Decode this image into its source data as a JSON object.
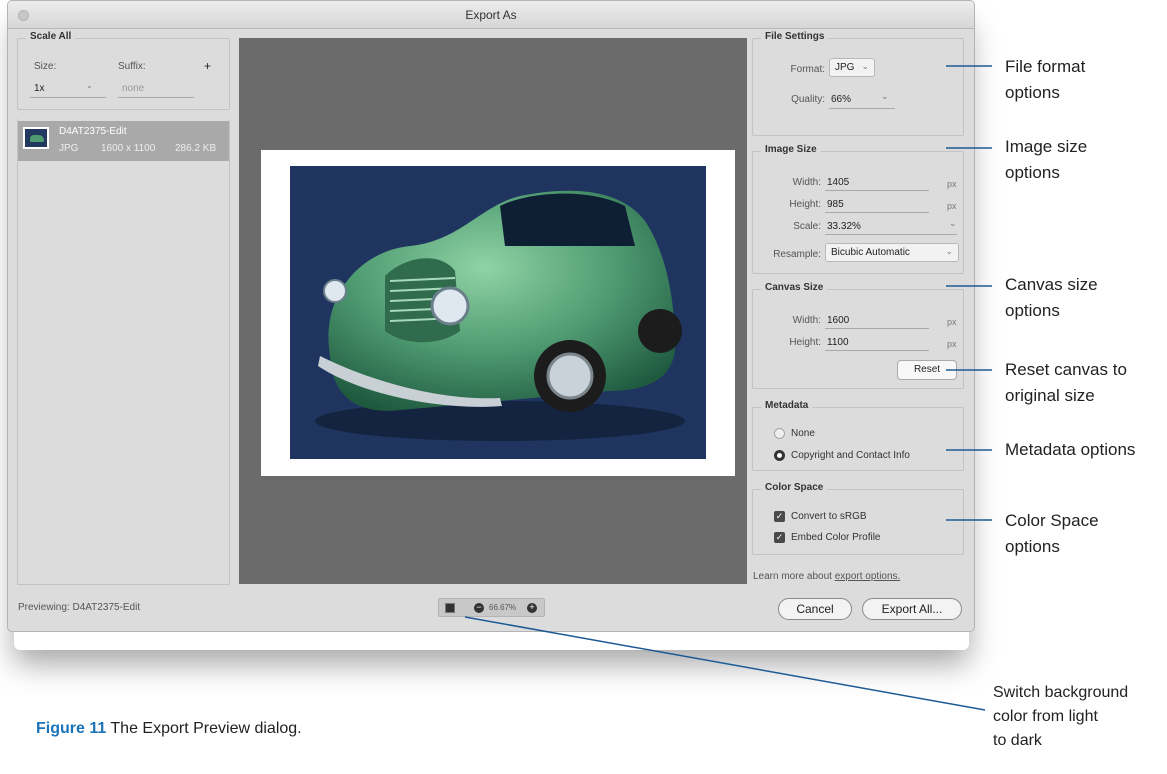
{
  "window": {
    "title": "Export As"
  },
  "scale_all": {
    "title": "Scale All",
    "size_label": "Size:",
    "suffix_label": "Suffix:",
    "add_symbol": "+",
    "size_value": "1x",
    "suffix_value": "none"
  },
  "file": {
    "name": "D4AT2375-Edit",
    "format": "JPG",
    "dimensions": "1600 x 1100",
    "filesize": "286.2 KB"
  },
  "file_settings": {
    "title": "File Settings",
    "format_label": "Format:",
    "format_value": "JPG",
    "quality_label": "Quality:",
    "quality_value": "66%"
  },
  "image_size": {
    "title": "Image Size",
    "width_label": "Width:",
    "width_value": "1405",
    "height_label": "Height:",
    "height_value": "985",
    "scale_label": "Scale:",
    "scale_value": "33.32%",
    "resample_label": "Resample:",
    "resample_value": "Bicubic Automatic",
    "unit": "px"
  },
  "canvas_size": {
    "title": "Canvas Size",
    "width_label": "Width:",
    "width_value": "1600",
    "height_label": "Height:",
    "height_value": "1100",
    "unit": "px",
    "reset_label": "Reset"
  },
  "metadata": {
    "title": "Metadata",
    "options": [
      "None",
      "Copyright and Contact Info"
    ],
    "selected": "Copyright and Contact Info"
  },
  "color_space": {
    "title": "Color Space",
    "options": [
      "Convert to sRGB",
      "Embed Color Profile"
    ]
  },
  "learn_more": {
    "prefix": "Learn more about ",
    "link": "export options."
  },
  "footer": {
    "previewing": "Previewing: D4AT2375-Edit",
    "zoom": "66.67%",
    "cancel_label": "Cancel",
    "export_label": "Export All..."
  },
  "callouts": {
    "file_format": [
      "File format",
      "options"
    ],
    "image_size": [
      "Image size",
      "options"
    ],
    "canvas_size": [
      "Canvas size",
      "options"
    ],
    "reset": [
      "Reset canvas to",
      "original size"
    ],
    "metadata": [
      "Metadata options"
    ],
    "color_space": [
      "Color Space",
      "options"
    ],
    "background": [
      "Switch background",
      "color from light",
      "to dark"
    ]
  },
  "caption": {
    "label": "Figure 11",
    "text": " The Export Preview dialog."
  },
  "colors": {
    "callout_line": "#1d5a94",
    "caption_accent": "#1b73b8",
    "preview_bg": "#6b6b6b",
    "photo_bg": "#1f355f",
    "car": "#4e9a71"
  }
}
